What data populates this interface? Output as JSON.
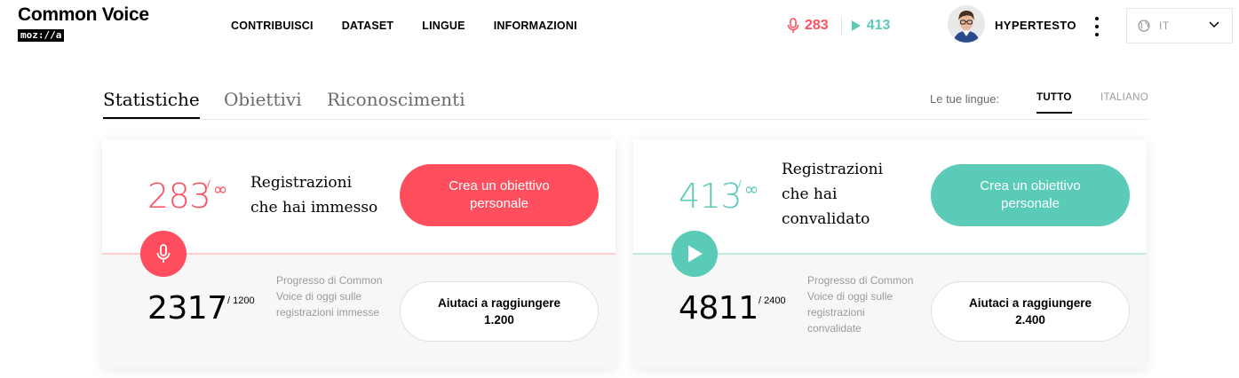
{
  "brand": {
    "title": "Common Voice",
    "sub_logo": "moz://a"
  },
  "nav": {
    "items": [
      "CONTRIBUISCI",
      "DATASET",
      "LINGUE",
      "INFORMAZIONI"
    ]
  },
  "header_counters": {
    "recordings": "283",
    "validations": "413",
    "recording_icon": "microphone-icon",
    "validation_icon": "play-icon"
  },
  "user": {
    "name": "HYPERTESTO",
    "avatar_icon": "avatar-icon"
  },
  "language_select": {
    "value": "IT",
    "icon": "globe-icon"
  },
  "tabs": {
    "items": [
      "Statistiche",
      "Obiettivi",
      "Riconoscimenti"
    ],
    "active_index": 0
  },
  "language_filter": {
    "label": "Le tue lingue:",
    "options": [
      "TUTTO",
      "ITALIANO"
    ],
    "active_index": 0
  },
  "cards": [
    {
      "accent_color": "#ff4f5e",
      "count": "283",
      "goal_slash": "/",
      "goal_symbol": "∞",
      "label_lines": [
        "Registrazioni",
        "che hai immesso"
      ],
      "goal_button": "Crea un obiettivo personale",
      "icon": "microphone-icon",
      "progress_count": "2317",
      "progress_goal": "/ 1200",
      "progress_desc": "Progresso di Common Voice di oggi sulle registrazioni immesse",
      "help_button_line1": "Aiutaci a raggiungere",
      "help_button_line2": "1.200"
    },
    {
      "accent_color": "#59cbb7",
      "count": "413",
      "goal_slash": "/",
      "goal_symbol": "∞",
      "label_lines": [
        "Registrazioni",
        "che hai",
        "convalidato"
      ],
      "goal_button": "Crea un obiettivo personale",
      "icon": "play-icon",
      "progress_count": "4811",
      "progress_goal": "/ 2400",
      "progress_desc": "Progresso di Common Voice di oggi sulle registrazioni convalidate",
      "help_button_line1": "Aiutaci a raggiungere",
      "help_button_line2": "2.400"
    }
  ]
}
